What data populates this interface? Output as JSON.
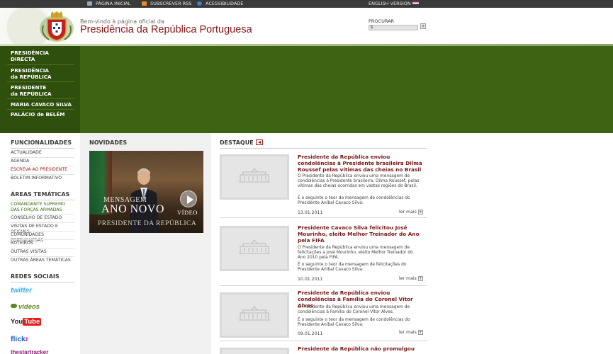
{
  "topbar": {
    "home": "PÁGINA INICIAL",
    "rss": "SUBSCREVER RSS",
    "accessibility": "ACESSIBILIDADE",
    "english": "ENGLISH VERSION"
  },
  "header": {
    "welcome": "Bem-vindo à página oficial da",
    "title": "Presidência da República Portuguesa",
    "search_label": "PROCURAR",
    "search_value": "$",
    "search_button": "+"
  },
  "banner_nav": [
    {
      "line1": "PRESIDÊNCIA",
      "line2": "DIRECTA"
    },
    {
      "line1": "PRESIDÊNCIA",
      "line2": "da REPÚBLICA"
    },
    {
      "line1": "PRESIDENTE",
      "line2": "da REPÚBLICA"
    },
    {
      "line1": "MARIA CAVACO SILVA",
      "line2": ""
    },
    {
      "line1": "PALÁCIO de BELÉM",
      "line2": ""
    }
  ],
  "sidebar": {
    "funcionalidades_title": "FUNCIONALIDADES",
    "funcionalidades": [
      "ACTUALIDADE",
      "AGENDA",
      "ESCREVA AO PRESIDENTE",
      "BOLETIM INFORMATIVO"
    ],
    "areas_title": "ÁREAS TEMÁTICAS",
    "areas": [
      "COMANDANTE SUPREMO DAS FORÇAS ARMADAS",
      "CONSELHO DE ESTADO",
      "VISITAS DE ESTADO E OFICIAIS",
      "COMUNIDADES PORTUGUESAS",
      "ROTEIROS",
      "OUTRAS VISITAS",
      "OUTRAS ÁREAS TEMÁTICAS"
    ],
    "social_title": "REDES SOCIAIS",
    "social": {
      "twitter": "twitter",
      "videos": "videos",
      "youtube_you": "You",
      "youtube_tube": "Tube",
      "flickr_a": "flick",
      "flickr_b": "r",
      "tracker": "thestartracker"
    }
  },
  "novidades": {
    "title": "NOVIDADES",
    "promo_line1": "MENSAGEM",
    "promo_line2": "ANO NOVO",
    "promo_line3": "PRESIDENTE DA REPÚBLICA",
    "promo_video": "VÍDEO"
  },
  "destaque": {
    "title": "DESTAQUE",
    "more_label": "ler mais",
    "articles": [
      {
        "title": "Presidente da República enviou condolências à Presidente brasileira Dilma Roussef pelas vítimas das cheias no Brasil",
        "p1": "O Presidente da República enviou uma mensagem de condolências à Presidente brasileira, Dilma Roussef, pelas vítimas das cheias ocorridas em vastas regiões do Brasil.",
        "p2": "É o seguinte o teor da mensagem de condolências do Presidente Aníbal Cavaco Silva:",
        "date": "13.01.2011"
      },
      {
        "title": "Presidente Cavaco Silva felicitou José Mourinho, eleito Melhor Treinador do Ano pela FIFA",
        "p1": "O Presidente da República enviou uma mensagem de felicitações a José Mourinho, eleito Melhor Treinador do Ano 2010 pela FIFA.",
        "p2": "É o seguinte o teor da mensagem de felicitações do Presidente Aníbal Cavaco Silva:",
        "date": "10.01.2011"
      },
      {
        "title": "Presidente da República enviou condolências à Família do Coronel Vítor Alves",
        "p1": "O Presidente da República enviou uma mensagem de condolências à Família do Coronel Vítor Alves.",
        "p2": "É o seguinte o teor da mensagem de condolências do Presidente Aníbal Cavaco Silva:",
        "date": "09.01.2011"
      },
      {
        "title": "Presidente da República não promulgou",
        "p1": "",
        "p2": "",
        "date": ""
      }
    ]
  },
  "colors": {
    "brand_red": "#8a1616",
    "banner_green": "#3c6412",
    "sidebar_dark_green": "#2f4f0d",
    "topbar": "#3a3a3a"
  }
}
